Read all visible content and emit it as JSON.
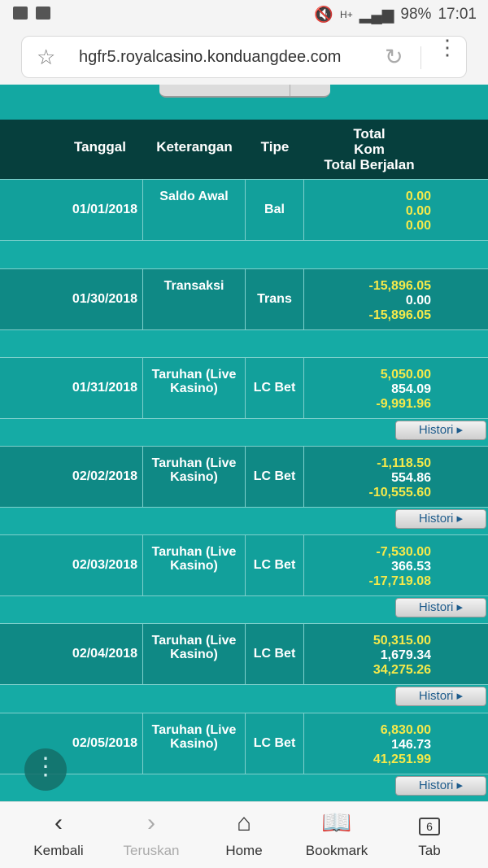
{
  "status": {
    "battery": "98%",
    "time": "17:01",
    "network": "H+"
  },
  "browser": {
    "url": "hgfr5.royalcasino.konduangdee.com"
  },
  "table": {
    "headers": {
      "date": "Tanggal",
      "desc": "Keterangan",
      "type": "Tipe",
      "total": "Total",
      "kom": "Kom",
      "running": "Total Berjalan"
    },
    "histori_label": "Histori ▸",
    "rows": [
      {
        "date": "01/01/2018",
        "desc": "Saldo Awal",
        "type": "Bal",
        "total": "0.00",
        "kom": "0.00",
        "running": "0.00"
      },
      {
        "date": "01/30/2018",
        "desc": "Transaksi",
        "type": "Trans",
        "total": "-15,896.05",
        "kom": "0.00",
        "running": "-15,896.05"
      },
      {
        "date": "01/31/2018",
        "desc": "Taruhan (Live Kasino)",
        "type": "LC Bet",
        "total": "5,050.00",
        "kom": "854.09",
        "running": "-9,991.96"
      },
      {
        "date": "02/02/2018",
        "desc": "Taruhan (Live Kasino)",
        "type": "LC Bet",
        "total": "-1,118.50",
        "kom": "554.86",
        "running": "-10,555.60"
      },
      {
        "date": "02/03/2018",
        "desc": "Taruhan (Live Kasino)",
        "type": "LC Bet",
        "total": "-7,530.00",
        "kom": "366.53",
        "running": "-17,719.08"
      },
      {
        "date": "02/04/2018",
        "desc": "Taruhan (Live Kasino)",
        "type": "LC Bet",
        "total": "50,315.00",
        "kom": "1,679.34",
        "running": "34,275.26"
      },
      {
        "date": "02/05/2018",
        "desc": "Taruhan (Live Kasino)",
        "type": "LC Bet",
        "total": "6,830.00",
        "kom": "146.73",
        "running": "41,251.99"
      }
    ]
  },
  "nav": {
    "back": "Kembali",
    "forward": "Teruskan",
    "home": "Home",
    "bookmark": "Bookmark",
    "tab": "Tab",
    "tab_count": "6"
  }
}
